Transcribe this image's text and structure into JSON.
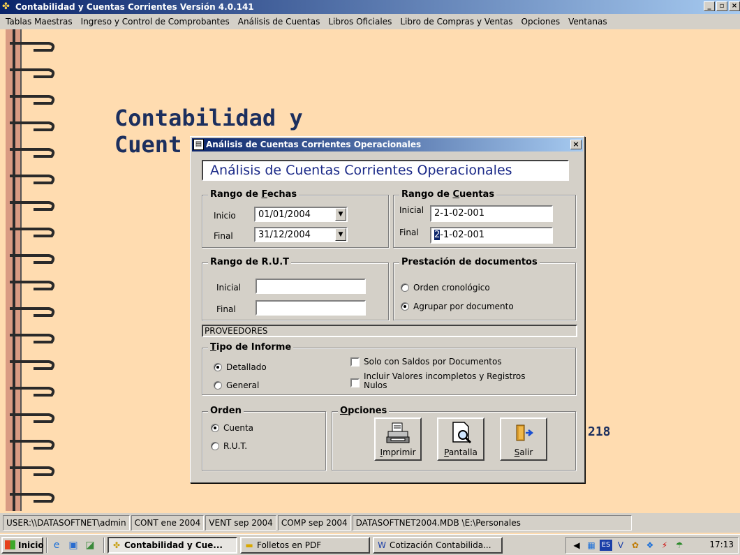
{
  "app": {
    "title": "Contabilidad y Cuentas Corrientes  Versión 4.0.141",
    "controls": {
      "minimize": "_",
      "maximize": "▫",
      "close": "×"
    }
  },
  "menu": [
    "Tablas Maestras",
    "Ingreso y Control de Comprobantes",
    "Análisis de Cuentas",
    "Libros Oficiales",
    "Libro de Compras y Ventas",
    "Opciones",
    "Ventanas"
  ],
  "background": {
    "title_line1": "Contabilidad y",
    "title_line2": "Cuent",
    "number": "218"
  },
  "dialog": {
    "title": "Análisis de Cuentas Corrientes Operacionales",
    "heading": "Análisis de Cuentas Corrientes Operacionales",
    "close": "×",
    "rango_fechas": {
      "legend_pre": "Rango de ",
      "legend_u": "F",
      "legend_post": "echas",
      "inicio_label": "Inicio",
      "inicio_value": "01/01/2004",
      "final_label": "Final",
      "final_value": "31/12/2004"
    },
    "rango_cuentas": {
      "legend_pre": "Rango de ",
      "legend_u": "C",
      "legend_post": "uentas",
      "inicial_label": "Inicial",
      "inicial_value": "2-1-02-001",
      "final_label": "Final",
      "final_value_sel": "2",
      "final_value_rest": "-1-02-001"
    },
    "rango_rut": {
      "legend": "Rango de R.U.T",
      "inicial_label": "Inicial",
      "inicial_value": "",
      "final_label": "Final",
      "final_value": ""
    },
    "prestacion": {
      "legend": "Prestación de documentos",
      "options": [
        "Orden cronológico",
        "Agrupar por documento"
      ],
      "selected": 1
    },
    "proveedores": "PROVEEDORES",
    "tipo_informe": {
      "legend_u": "T",
      "legend_post": "ipo de Informe",
      "options": [
        "Detallado",
        "General"
      ],
      "selected": 0,
      "check1": "Solo con  Saldos por Documentos",
      "check2": "Incluir Valores incompletos y Registros Nulos"
    },
    "orden": {
      "legend": "Orden",
      "options": [
        "Cuenta",
        "R.U.T."
      ],
      "selected": 0
    },
    "opciones": {
      "legend_u": "O",
      "legend_post": "pciones",
      "buttons": [
        {
          "u": "I",
          "rest": "mprimir",
          "icon": "printer-icon"
        },
        {
          "u": "P",
          "rest": "antalla",
          "icon": "preview-icon"
        },
        {
          "u": "S",
          "rest": "alir",
          "icon": "exit-door-icon"
        }
      ]
    }
  },
  "statusbar": [
    "USER:\\\\DATASOFTNET\\admin",
    "CONT ene 2004",
    "VENT sep 2004",
    "COMP sep 2004",
    "DATASOFTNET2004.MDB \\E:\\Personales"
  ],
  "taskbar": {
    "start": "Inicio",
    "tasks": [
      {
        "label": "Contabilidad y Cue...",
        "active": true
      },
      {
        "label": "Folletos en PDF",
        "active": false
      },
      {
        "label": "Cotización Contabilida...",
        "active": false
      }
    ],
    "clock": "17:13",
    "tray_lang": "ES"
  }
}
